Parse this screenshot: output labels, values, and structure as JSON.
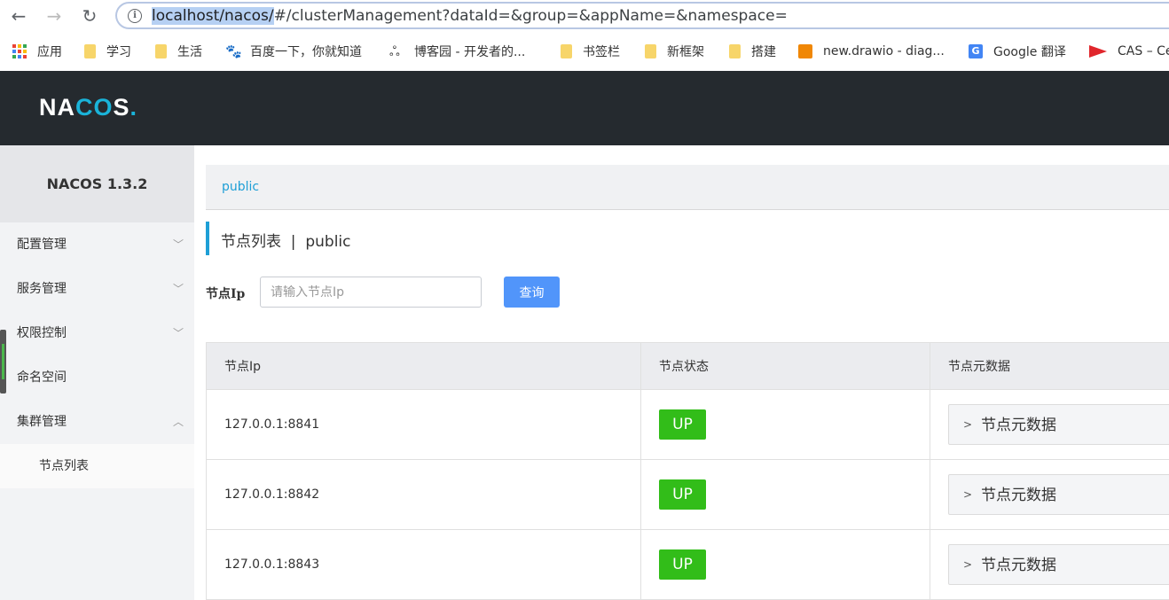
{
  "browser": {
    "url_host": "localhost/nacos/",
    "url_rest": "#/clusterManagement?dataId=&group=&appName=&namespace=",
    "bookmarks": [
      {
        "label": "应用",
        "icon": "apps-grid-icon"
      },
      {
        "label": "学习",
        "icon": "folder-icon"
      },
      {
        "label": "生活",
        "icon": "folder-icon"
      },
      {
        "label": "百度一下，你就知道",
        "icon": "baidu-paw-icon"
      },
      {
        "label": "博客园 - 开发者的...",
        "icon": "cnblogs-icon"
      },
      {
        "label": "书签栏",
        "icon": "folder-icon"
      },
      {
        "label": "新框架",
        "icon": "folder-icon"
      },
      {
        "label": "搭建",
        "icon": "folder-icon"
      },
      {
        "label": "new.drawio - diag...",
        "icon": "drawio-icon"
      },
      {
        "label": "Google 翻译",
        "icon": "google-translate-icon"
      },
      {
        "label": "CAS – Ce",
        "icon": "cas-flag-icon"
      }
    ]
  },
  "header": {
    "logo_left": "NA",
    "logo_mid": "CO",
    "logo_right": "S",
    "logo_dot": "."
  },
  "sidebar": {
    "title": "NACOS 1.3.2",
    "items": [
      {
        "label": "配置管理",
        "chevron": "﹀"
      },
      {
        "label": "服务管理",
        "chevron": "﹀"
      },
      {
        "label": "权限控制",
        "chevron": "﹀"
      },
      {
        "label": "命名空间",
        "chevron": ""
      },
      {
        "label": "集群管理",
        "chevron": "︿"
      }
    ],
    "sub_items": [
      {
        "label": "节点列表"
      }
    ]
  },
  "main": {
    "breadcrumb": "public",
    "title": "节点列表  |  public",
    "filter": {
      "label": "节点Ip",
      "placeholder": "请输入节点Ip",
      "button": "查询"
    },
    "table": {
      "columns": [
        "节点Ip",
        "节点状态",
        "节点元数据"
      ],
      "rows": [
        {
          "ip": "127.0.0.1:8841",
          "status": "UP",
          "meta": "节点元数据"
        },
        {
          "ip": "127.0.0.1:8842",
          "status": "UP",
          "meta": "节点元数据"
        },
        {
          "ip": "127.0.0.1:8843",
          "status": "UP",
          "meta": "节点元数据"
        }
      ]
    }
  },
  "colors": {
    "accent": "#1e9fd6",
    "status_up": "#32bd19",
    "primary_button": "#5195fa",
    "header_bg": "#252a2f"
  }
}
